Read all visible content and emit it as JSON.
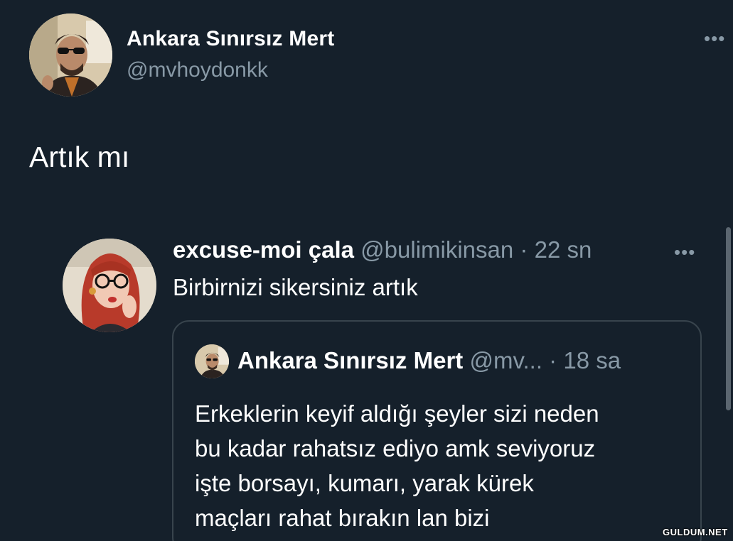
{
  "main_tweet": {
    "display_name": "Ankara Sınırsız Mert",
    "handle": "@mvhoydonkk",
    "text": "Artık mı",
    "more_icon": "more-horizontal-icon"
  },
  "reply_tweet": {
    "display_name": "excuse-moi çala",
    "handle": "@bulimikinsan",
    "separator": "·",
    "time": "22 sn",
    "text": "Birbirnizi sikersiniz artık",
    "more_icon": "more-horizontal-icon"
  },
  "quoted_tweet": {
    "display_name": "Ankara Sınırsız Mert",
    "handle": "@mv...",
    "separator": "·",
    "time": "18 sa",
    "lines": [
      "Erkeklerin keyif aldığı şeyler sizi neden",
      "bu kadar rahatsız ediyo amk seviyoruz",
      "işte borsayı, kumarı, yarak kürek",
      "maçları rahat bırakın lan bizi"
    ]
  },
  "watermark": "GULDUM.NET",
  "colors": {
    "background": "#15202b",
    "primary_text": "#ffffff",
    "secondary_text": "#8899a6",
    "card_border": "#38444d"
  }
}
